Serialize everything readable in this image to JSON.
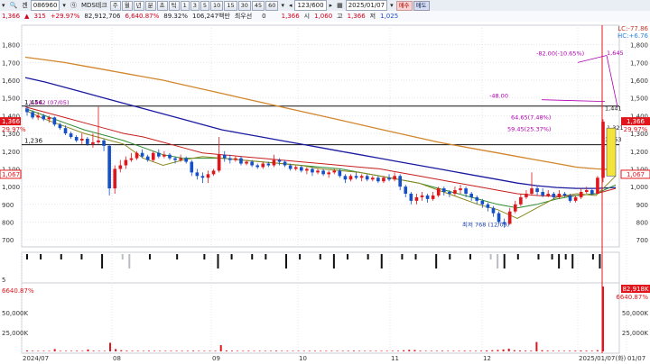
{
  "toolbar1": {
    "code": "086960",
    "stock_name": "MDS테크",
    "periods": [
      "주",
      "월",
      "년",
      "분",
      "초",
      "틱"
    ],
    "intervals": [
      "1",
      "3",
      "5",
      "10",
      "15",
      "30",
      "45",
      "60"
    ],
    "count": "123/600",
    "date": "2025/01/07",
    "buy_label": "매수",
    "sell_label": "매도"
  },
  "toolbar2": {
    "price": "1,366",
    "change": "315",
    "change_pct": "+29.97%",
    "volume": "82,912,706",
    "vol_ratio": "6,640.87%",
    "turnover_pct": "89.32%",
    "amount": "106,247백만",
    "pref_label": "최우선",
    "pref_val": "0",
    "cur_val": "1,366",
    "open_label": "시",
    "open_val": "1,060",
    "high_label": "고",
    "high_val": "1,366",
    "low_label": "저",
    "low_val": "1,025"
  },
  "chart_data": {
    "type": "candlestick",
    "xlabel": "",
    "ylabel": "",
    "ylim": [
      650,
      1900
    ],
    "y_ticks": [
      "1,800",
      "1,700",
      "1,600",
      "1,500",
      "1,400",
      "1,300",
      "1,200",
      "1,100",
      "1,000",
      "900",
      "800",
      "700"
    ],
    "x_ticks": [
      "2024/07",
      "08",
      "09",
      "10",
      "11",
      "12",
      "2025/01/07(화)",
      "01/07"
    ],
    "hlines": [
      {
        "value": 1454,
        "label": "1,454"
      },
      {
        "value": 1236,
        "label": "1,236"
      }
    ],
    "right_labels": {
      "lc": "LC:-77.86",
      "hc": "HC:+6.76",
      "price_tag": "1,366",
      "pct_tag": "29.97%",
      "low_tag": "1,067"
    },
    "left_labels": {
      "price_tag": "1,366",
      "pct_tag": "29.97%",
      "low_tag": "1,067"
    },
    "annotations": [
      {
        "text": "최저 768 (12/09)",
        "color": "#1a3fae"
      },
      {
        "text": "-82.00(-10.65%)",
        "color": "#b000b0"
      },
      {
        "text": "1,645",
        "color": "#b000b0"
      },
      {
        "text": "-48.00",
        "color": "#b000b0"
      },
      {
        "text": "64.65(7.48%)",
        "color": "#b000b0"
      },
      {
        "text": "59.45(25.37%)",
        "color": "#b000b0"
      },
      {
        "text": "1,441",
        "color": "#222"
      },
      {
        "text": "1,253",
        "color": "#222"
      },
      {
        "text": "1,321",
        "color": "#222"
      },
      {
        "text": "1,462 (07/05)",
        "color": "#b000b0"
      }
    ],
    "candles_approx": [
      [
        1440,
        1420,
        1460,
        1400
      ],
      [
        1420,
        1390,
        1430,
        1380
      ],
      [
        1390,
        1400,
        1420,
        1375
      ],
      [
        1400,
        1380,
        1410,
        1370
      ],
      [
        1380,
        1390,
        1400,
        1360
      ],
      [
        1390,
        1350,
        1395,
        1340
      ],
      [
        1350,
        1330,
        1360,
        1320
      ],
      [
        1330,
        1300,
        1345,
        1290
      ],
      [
        1300,
        1280,
        1310,
        1270
      ],
      [
        1280,
        1260,
        1290,
        1250
      ],
      [
        1260,
        1270,
        1300,
        1240
      ],
      [
        1270,
        1240,
        1280,
        1230
      ],
      [
        1240,
        1250,
        1300,
        1220
      ],
      [
        1250,
        1260,
        1450,
        1240
      ],
      [
        1260,
        1230,
        1270,
        1200
      ],
      [
        1230,
        990,
        1240,
        950
      ],
      [
        990,
        1100,
        1120,
        960
      ],
      [
        1100,
        1120,
        1150,
        1080
      ],
      [
        1120,
        1150,
        1170,
        1100
      ],
      [
        1150,
        1160,
        1190,
        1140
      ],
      [
        1160,
        1190,
        1200,
        1150
      ],
      [
        1190,
        1170,
        1210,
        1160
      ],
      [
        1170,
        1150,
        1180,
        1140
      ],
      [
        1150,
        1190,
        1200,
        1140
      ],
      [
        1190,
        1170,
        1210,
        1160
      ],
      [
        1170,
        1180,
        1200,
        1160
      ],
      [
        1180,
        1160,
        1190,
        1150
      ],
      [
        1160,
        1150,
        1170,
        1130
      ],
      [
        1150,
        1160,
        1180,
        1140
      ],
      [
        1160,
        1140,
        1170,
        1130
      ],
      [
        1140,
        1080,
        1150,
        1060
      ],
      [
        1080,
        1060,
        1100,
        1040
      ],
      [
        1060,
        1050,
        1080,
        1020
      ],
      [
        1050,
        1070,
        1090,
        1020
      ],
      [
        1070,
        1090,
        1100,
        1060
      ],
      [
        1090,
        1180,
        1280,
        1080
      ],
      [
        1180,
        1160,
        1200,
        1140
      ],
      [
        1160,
        1150,
        1180,
        1130
      ],
      [
        1150,
        1160,
        1170,
        1140
      ],
      [
        1160,
        1130,
        1170,
        1120
      ],
      [
        1130,
        1140,
        1150,
        1120
      ],
      [
        1140,
        1120,
        1150,
        1110
      ],
      [
        1120,
        1110,
        1130,
        1100
      ],
      [
        1110,
        1130,
        1140,
        1100
      ],
      [
        1130,
        1120,
        1140,
        1110
      ],
      [
        1120,
        1150,
        1180,
        1110
      ],
      [
        1150,
        1140,
        1160,
        1120
      ],
      [
        1140,
        1120,
        1150,
        1110
      ],
      [
        1120,
        1100,
        1130,
        1090
      ],
      [
        1100,
        1110,
        1120,
        1090
      ],
      [
        1110,
        1090,
        1120,
        1080
      ],
      [
        1090,
        1100,
        1110,
        1070
      ],
      [
        1100,
        1080,
        1110,
        1060
      ],
      [
        1080,
        1090,
        1100,
        1070
      ],
      [
        1090,
        1070,
        1100,
        1060
      ],
      [
        1070,
        1080,
        1090,
        1050
      ],
      [
        1080,
        1090,
        1100,
        1070
      ],
      [
        1090,
        1060,
        1100,
        1050
      ],
      [
        1060,
        1040,
        1070,
        1020
      ],
      [
        1040,
        1060,
        1070,
        1030
      ],
      [
        1060,
        1050,
        1080,
        1040
      ],
      [
        1050,
        1060,
        1070,
        1030
      ],
      [
        1060,
        1040,
        1070,
        1030
      ],
      [
        1040,
        1050,
        1060,
        1030
      ],
      [
        1050,
        1030,
        1060,
        1020
      ],
      [
        1030,
        1050,
        1060,
        1020
      ],
      [
        1050,
        1040,
        1070,
        1030
      ],
      [
        1040,
        1060,
        1080,
        1030
      ],
      [
        1060,
        1000,
        1070,
        980
      ],
      [
        1000,
        960,
        1010,
        940
      ],
      [
        960,
        920,
        970,
        900
      ],
      [
        920,
        940,
        960,
        900
      ],
      [
        940,
        950,
        970,
        920
      ],
      [
        950,
        930,
        960,
        910
      ],
      [
        930,
        950,
        970,
        920
      ],
      [
        950,
        990,
        1000,
        940
      ],
      [
        990,
        970,
        1000,
        950
      ],
      [
        970,
        960,
        980,
        940
      ],
      [
        960,
        980,
        1000,
        950
      ],
      [
        980,
        990,
        1010,
        960
      ],
      [
        990,
        960,
        1000,
        940
      ],
      [
        960,
        940,
        970,
        920
      ],
      [
        940,
        920,
        950,
        900
      ],
      [
        920,
        900,
        930,
        880
      ],
      [
        900,
        880,
        910,
        860
      ],
      [
        880,
        850,
        890,
        830
      ],
      [
        850,
        800,
        860,
        790
      ],
      [
        800,
        790,
        820,
        768
      ],
      [
        790,
        860,
        880,
        785
      ],
      [
        860,
        900,
        920,
        850
      ],
      [
        900,
        940,
        960,
        890
      ],
      [
        940,
        960,
        980,
        930
      ],
      [
        960,
        990,
        1080,
        950
      ],
      [
        990,
        970,
        1000,
        950
      ],
      [
        970,
        950,
        990,
        940
      ],
      [
        950,
        960,
        980,
        940
      ],
      [
        960,
        940,
        970,
        930
      ],
      [
        940,
        960,
        980,
        930
      ],
      [
        960,
        950,
        970,
        940
      ],
      [
        950,
        920,
        960,
        910
      ],
      [
        920,
        940,
        950,
        910
      ],
      [
        940,
        970,
        990,
        930
      ],
      [
        970,
        980,
        1000,
        960
      ],
      [
        980,
        960,
        990,
        950
      ],
      [
        960,
        1050,
        1060,
        1040
      ],
      [
        1050,
        1366,
        1380,
        1025
      ]
    ],
    "series": [
      {
        "values": [
          1730,
          1715,
          1700,
          1680,
          1660,
          1640,
          1620,
          1600,
          1575,
          1550,
          1525,
          1500,
          1475,
          1450,
          1425,
          1400,
          1375,
          1350,
          1325,
          1300,
          1275,
          1250,
          1230,
          1210,
          1190,
          1170,
          1150,
          1130,
          1110,
          1100,
          1095
        ]
      },
      {
        "values": [
          1615,
          1590,
          1560,
          1530,
          1500,
          1470,
          1440,
          1410,
          1380,
          1350,
          1320,
          1300,
          1280,
          1260,
          1240,
          1220,
          1200,
          1180,
          1160,
          1140,
          1120,
          1100,
          1080,
          1060,
          1040,
          1020,
          1005,
          995,
          990,
          990,
          995
        ]
      },
      {
        "values": [
          1450,
          1420,
          1390,
          1360,
          1330,
          1300,
          1280,
          1250,
          1220,
          1190,
          1180,
          1170,
          1160,
          1150,
          1140,
          1130,
          1120,
          1110,
          1100,
          1080,
          1060,
          1040,
          1020,
          1000,
          980,
          960,
          950,
          945,
          950,
          960,
          990
        ]
      },
      {
        "values": [
          1440,
          1400,
          1360,
          1320,
          1290,
          1260,
          1220,
          1180,
          1160,
          1160,
          1160,
          1150,
          1140,
          1130,
          1120,
          1110,
          1100,
          1080,
          1060,
          1040,
          1020,
          990,
          960,
          930,
          900,
          880,
          900,
          930,
          950,
          960,
          1010
        ]
      },
      {
        "values": [
          1430,
          1380,
          1340,
          1300,
          1270,
          1240,
          1160,
          1120,
          1150,
          1170,
          1160,
          1150,
          1140,
          1130,
          1120,
          1100,
          1090,
          1080,
          1060,
          1040,
          1020,
          980,
          940,
          900,
          870,
          820,
          880,
          940,
          960,
          950,
          1060
        ]
      }
    ],
    "sub_bar_vals": [
      -1,
      0,
      -1,
      0,
      0,
      -1,
      0,
      0,
      -1,
      0,
      0,
      -2,
      0,
      0,
      -1,
      -2,
      0,
      0,
      -1,
      0,
      0,
      0,
      -1,
      0,
      0,
      0,
      -1,
      0,
      -2,
      0,
      -1,
      0,
      0,
      -1,
      0,
      -1,
      0,
      0,
      -2,
      0,
      -1,
      0,
      0,
      -1,
      0,
      -2,
      0,
      -1,
      0,
      0,
      -1,
      0,
      -2,
      0,
      0,
      -1,
      0,
      -1,
      0,
      0,
      -2,
      0,
      -1,
      0,
      0,
      -1,
      0,
      0,
      -1,
      -2,
      -2,
      0,
      -1,
      0,
      0,
      -1,
      0,
      -1,
      -2,
      -1,
      -2,
      0,
      0,
      -1,
      -2,
      0
    ],
    "volume_max_label": "82,918K",
    "volume_pct_label": "6640.87%",
    "volume_ticks": [
      "50,000K",
      "25,000K"
    ],
    "vol_ticks_left": [
      "50,000K",
      "25,000K"
    ],
    "volume_values": [
      1200,
      800,
      600,
      500,
      400,
      3000,
      700,
      500,
      400,
      800,
      600,
      2500,
      900,
      500,
      400,
      11000,
      3000,
      1500,
      900,
      700,
      600,
      500,
      800,
      600,
      500,
      400,
      700,
      500,
      600,
      400,
      900,
      700,
      500,
      600,
      800,
      8000,
      1200,
      900,
      700,
      600,
      800,
      500,
      600,
      700,
      500,
      900,
      600,
      500,
      400,
      600,
      500,
      700,
      600,
      500,
      400,
      500,
      600,
      700,
      800,
      900,
      600,
      500,
      400,
      700,
      600,
      500,
      400,
      800,
      1500,
      2000,
      1800,
      900,
      700,
      600,
      500,
      800,
      700,
      600,
      500,
      900,
      700,
      600,
      800,
      1200,
      1500,
      1800,
      2500,
      3500,
      1500,
      1200,
      1000,
      900,
      12000,
      1500,
      1000,
      800,
      700,
      600,
      800,
      900,
      1100,
      900,
      800,
      1500,
      82918
    ]
  },
  "sub_left_label": "5",
  "vol_left_pct": "6640.87%"
}
